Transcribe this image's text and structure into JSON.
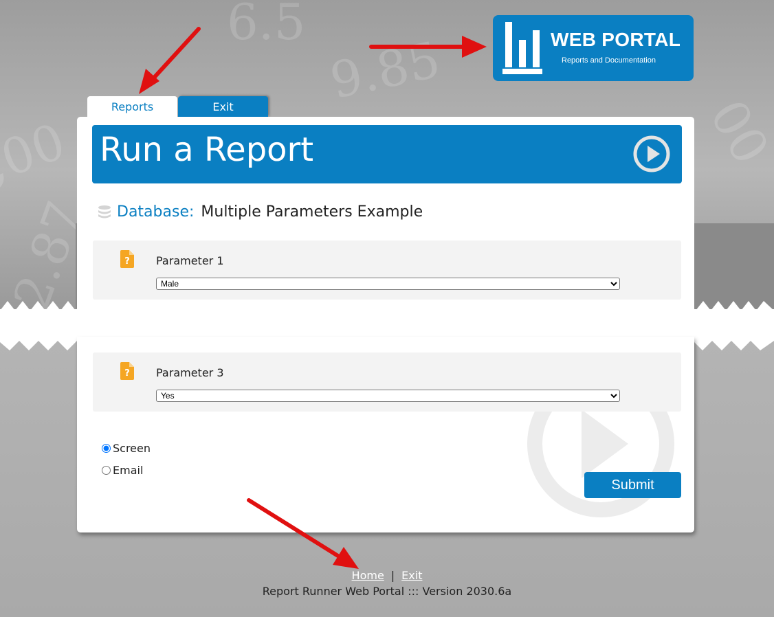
{
  "logo": {
    "title": "WEB PORTAL",
    "subtitle": "Reports and Documentation",
    "icon": "bar-chart-icon"
  },
  "tabs": [
    {
      "label": "Reports",
      "active": true
    },
    {
      "label": "Exit",
      "active": false
    }
  ],
  "banner": {
    "title": "Run a Report",
    "icon": "play-circle-icon"
  },
  "database": {
    "label": "Database:",
    "value": "Multiple Parameters Example",
    "icon": "database-icon"
  },
  "parameters": [
    {
      "label": "Parameter 1",
      "value": "Male",
      "icon": "question-file-icon"
    },
    {
      "label": "Parameter 3",
      "value": "Yes",
      "icon": "question-file-icon"
    }
  ],
  "output": {
    "options": [
      {
        "label": "Screen",
        "checked": true
      },
      {
        "label": "Email",
        "checked": false
      }
    ]
  },
  "submit_label": "Submit",
  "footer": {
    "home_label": "Home",
    "separator": "|",
    "exit_label": "Exit",
    "version": "Report Runner Web Portal ::: Version 2030.6a"
  },
  "colors": {
    "accent": "#0a7fc2",
    "icon_orange": "#f5a623",
    "annotation_red": "#e01010"
  }
}
